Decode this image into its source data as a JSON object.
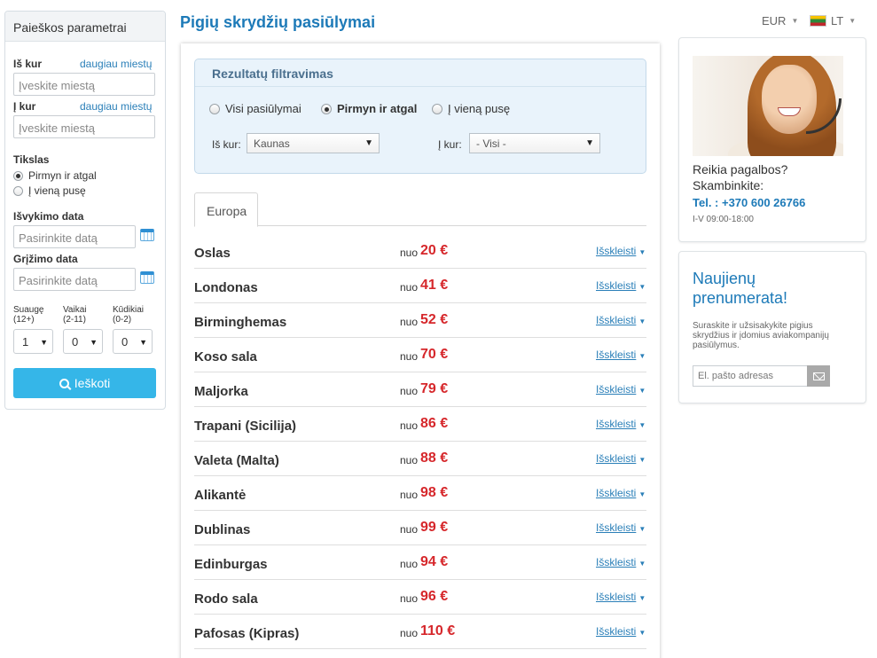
{
  "sidebar": {
    "title": "Paieškos parametrai",
    "from": {
      "label": "Iš kur",
      "more_link": "daugiau miestų",
      "placeholder": "Įveskite miestą"
    },
    "to": {
      "label": "Į kur",
      "more_link": "daugiau miestų",
      "placeholder": "Įveskite miestą"
    },
    "trip_type": {
      "label": "Tikslas",
      "options": [
        "Pirmyn ir atgal",
        "Į vieną pusę"
      ],
      "selected": 0
    },
    "departure": {
      "label": "Išvykimo data",
      "placeholder": "Pasirinkite datą"
    },
    "return": {
      "label": "Grįžimo data",
      "placeholder": "Pasirinkite datą"
    },
    "passengers": {
      "adults": {
        "label1": "Suaugę",
        "label2": "(12+)",
        "value": "1"
      },
      "children": {
        "label1": "Vaikai",
        "label2": "(2-11)",
        "value": "0"
      },
      "infants": {
        "label1": "Kūdikiai",
        "label2": "(0-2)",
        "value": "0"
      }
    },
    "search_button": "Ieškoti"
  },
  "header": {
    "title": "Pigių skrydžių pasiūlymai",
    "currency": "EUR",
    "language": "LT"
  },
  "filter": {
    "title": "Rezultatų filtravimas",
    "options": [
      "Visi pasiūlymai",
      "Pirmyn ir atgal",
      "Į vieną pusę"
    ],
    "selected": 1,
    "from_label": "Iš kur:",
    "from_value": "Kaunas",
    "to_label": "Į kur:",
    "to_value": "- Visi -"
  },
  "tabs": [
    "Europa"
  ],
  "offers": {
    "from_prefix": "nuo",
    "expand_label": "Išskleisti",
    "rows": [
      {
        "city": "Oslas",
        "price": "20 €"
      },
      {
        "city": "Londonas",
        "price": "41 €"
      },
      {
        "city": "Birminghemas",
        "price": "52 €"
      },
      {
        "city": "Koso sala",
        "price": "70 €"
      },
      {
        "city": "Maljorka",
        "price": "79 €"
      },
      {
        "city": "Trapani (Sicilija)",
        "price": "86 €"
      },
      {
        "city": "Valeta (Malta)",
        "price": "88 €"
      },
      {
        "city": "Alikantė",
        "price": "98 €"
      },
      {
        "city": "Dublinas",
        "price": "99 €"
      },
      {
        "city": "Edinburgas",
        "price": "94 €"
      },
      {
        "city": "Rodo sala",
        "price": "96 €"
      },
      {
        "city": "Pafosas (Kipras)",
        "price": "110 €"
      }
    ]
  },
  "help": {
    "question_line1": "Reikia pagalbos?",
    "question_line2": "Skambinkite:",
    "phone": "Tel. : +370 600 26766",
    "hours": "I-V 09:00-18:00"
  },
  "newsletter": {
    "title": "Naujienų prenumerata!",
    "text": "Suraskite ir užsisakykite pigius skrydžius ir įdomius aviakompanijų pasiūlymus.",
    "email_placeholder": "El. pašto adresas"
  },
  "colors": {
    "accent": "#1d7ab8",
    "price": "#d6272b",
    "button": "#35b6e8"
  }
}
